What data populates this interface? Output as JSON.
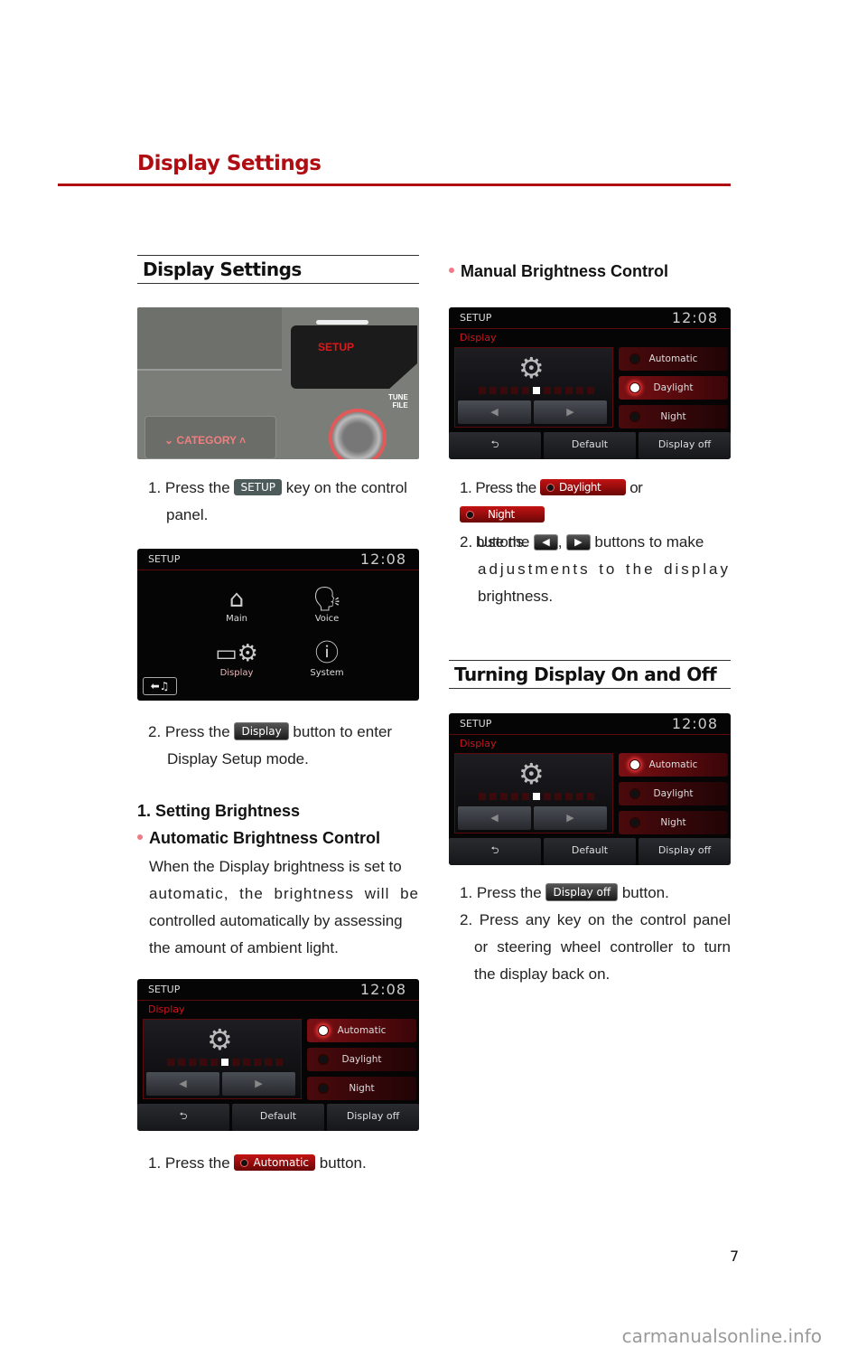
{
  "header": {
    "title": "Display Settings"
  },
  "left": {
    "section_title": "Display Settings",
    "photo": {
      "setup_label": "SETUP",
      "tune_label": "TUNE",
      "file_label": "FILE",
      "category_label": "CATEGORY"
    },
    "step1": {
      "prefix": "1. Press the",
      "button": "SETUP",
      "suffix": "key on the control",
      "cont": "panel."
    },
    "setup_menu": {
      "title": "SETUP",
      "time": "12:08",
      "items": [
        "Main",
        "Voice",
        "Display",
        "System"
      ],
      "back_icon": "back-music-icon"
    },
    "step2": {
      "prefix": "2. Press  the",
      "button": "Display",
      "suffix": "button  to  enter",
      "cont": "Display Setup mode."
    },
    "brightness_heading": "1. Setting Brightness",
    "auto_heading": "Automatic Brightness Control",
    "auto_text": [
      "When the Display brightness is set to",
      "automatic, the brightness will be",
      "controlled automatically by assessing",
      "the amount of ambient light."
    ],
    "screen": {
      "title": "SETUP",
      "time": "12:08",
      "subtitle": "Display",
      "selected": "Automatic"
    },
    "step_auto": {
      "prefix": "1. Press the",
      "button": "Automatic",
      "suffix": "button."
    }
  },
  "right": {
    "manual_heading": "Manual Brightness Control",
    "screen": {
      "title": "SETUP",
      "time": "12:08",
      "subtitle": "Display",
      "selected": "Daylight"
    },
    "step1": {
      "prefix": "1. Press the",
      "button1": "Daylight",
      "or": "or",
      "button2": "Night",
      "cont": "buttons."
    },
    "step2": {
      "prefix": "2. Use the",
      "left_btn": "◀",
      "comma": ",",
      "right_btn": "▶",
      "suffix": "buttons to make",
      "cont1": "adjustments to the display",
      "cont2": "brightness."
    },
    "section_title": "Turning Display On and Off",
    "screen2": {
      "title": "SETUP",
      "time": "12:08",
      "subtitle": "Display",
      "selected": "Automatic"
    },
    "off_step1": {
      "prefix": "1. Press the",
      "button": "Display off",
      "suffix": "button."
    },
    "off_step2": [
      "2. Press any key on the control panel",
      "or steering wheel controller to turn",
      "the display back on."
    ]
  },
  "display_screen_common": {
    "modes": [
      "Automatic",
      "Daylight",
      "Night"
    ],
    "bottom": [
      "⮌",
      "Default",
      "Display off"
    ],
    "brightness_level": 6,
    "brightness_steps": 11
  },
  "page_number": "7",
  "watermark": "carmanualsonline.info",
  "colors": {
    "accent": "#b00d12",
    "bullet": "#f07a86"
  }
}
